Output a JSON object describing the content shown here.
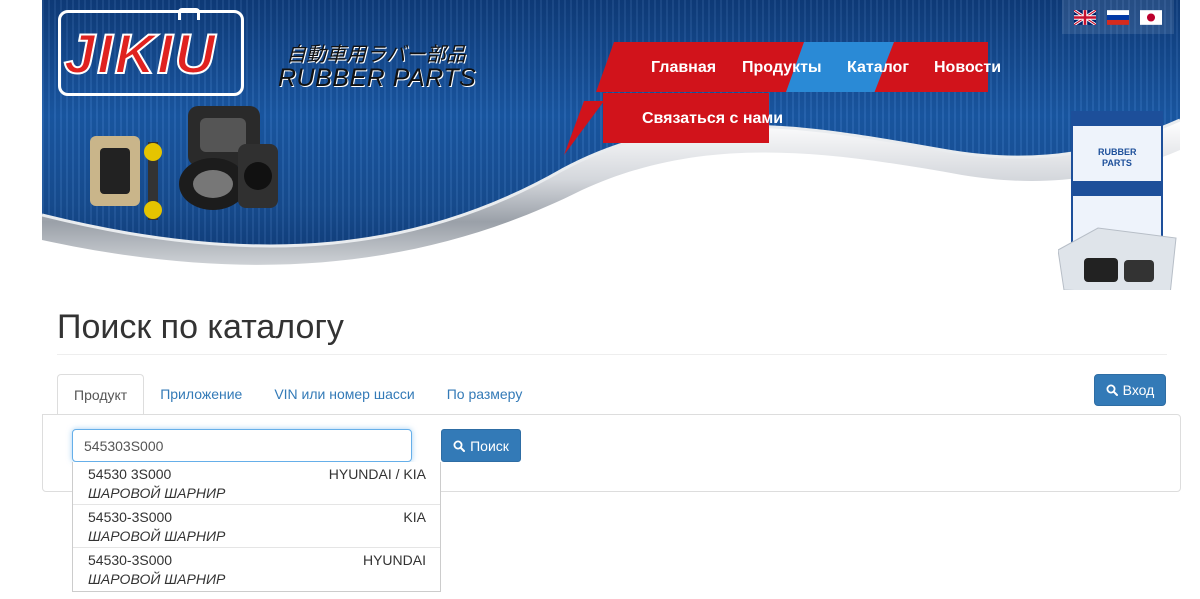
{
  "header": {
    "logo": "JIKIU",
    "tagline_jp": "自動車用ラバー部品",
    "tagline_en": "RUBBER PARTS"
  },
  "nav": {
    "items": [
      {
        "label": "Главная"
      },
      {
        "label": "Продукты"
      },
      {
        "label": "Каталог"
      },
      {
        "label": "Новости"
      },
      {
        "label": "Связаться с нами"
      }
    ],
    "active": "Каталог"
  },
  "colors": {
    "nav_red": "#d1131b",
    "nav_active_blue": "#2a8ad6",
    "primary_button": "#337ab7",
    "link": "#337ab7"
  },
  "languages": [
    "en-flag-icon",
    "ru-flag-icon",
    "jp-flag-icon"
  ],
  "page": {
    "title": "Поиск по каталогу"
  },
  "tabs": [
    {
      "label": "Продукт",
      "active": true
    },
    {
      "label": "Приложение"
    },
    {
      "label": "VIN или номер шасси"
    },
    {
      "label": "По размеру"
    }
  ],
  "login_label": "Вход",
  "search": {
    "value": "545303S000",
    "button_label": "Поиск"
  },
  "suggestions": [
    {
      "code": "54530 3S000",
      "brand": "HYUNDAI / KIA",
      "description": "ШАРОВОЙ ШАРНИР"
    },
    {
      "code": "54530-3S000",
      "brand": "KIA",
      "description": "ШАРОВОЙ ШАРНИР"
    },
    {
      "code": "54530-3S000",
      "brand": "HYUNDAI",
      "description": "ШАРОВОЙ ШАРНИР"
    }
  ]
}
